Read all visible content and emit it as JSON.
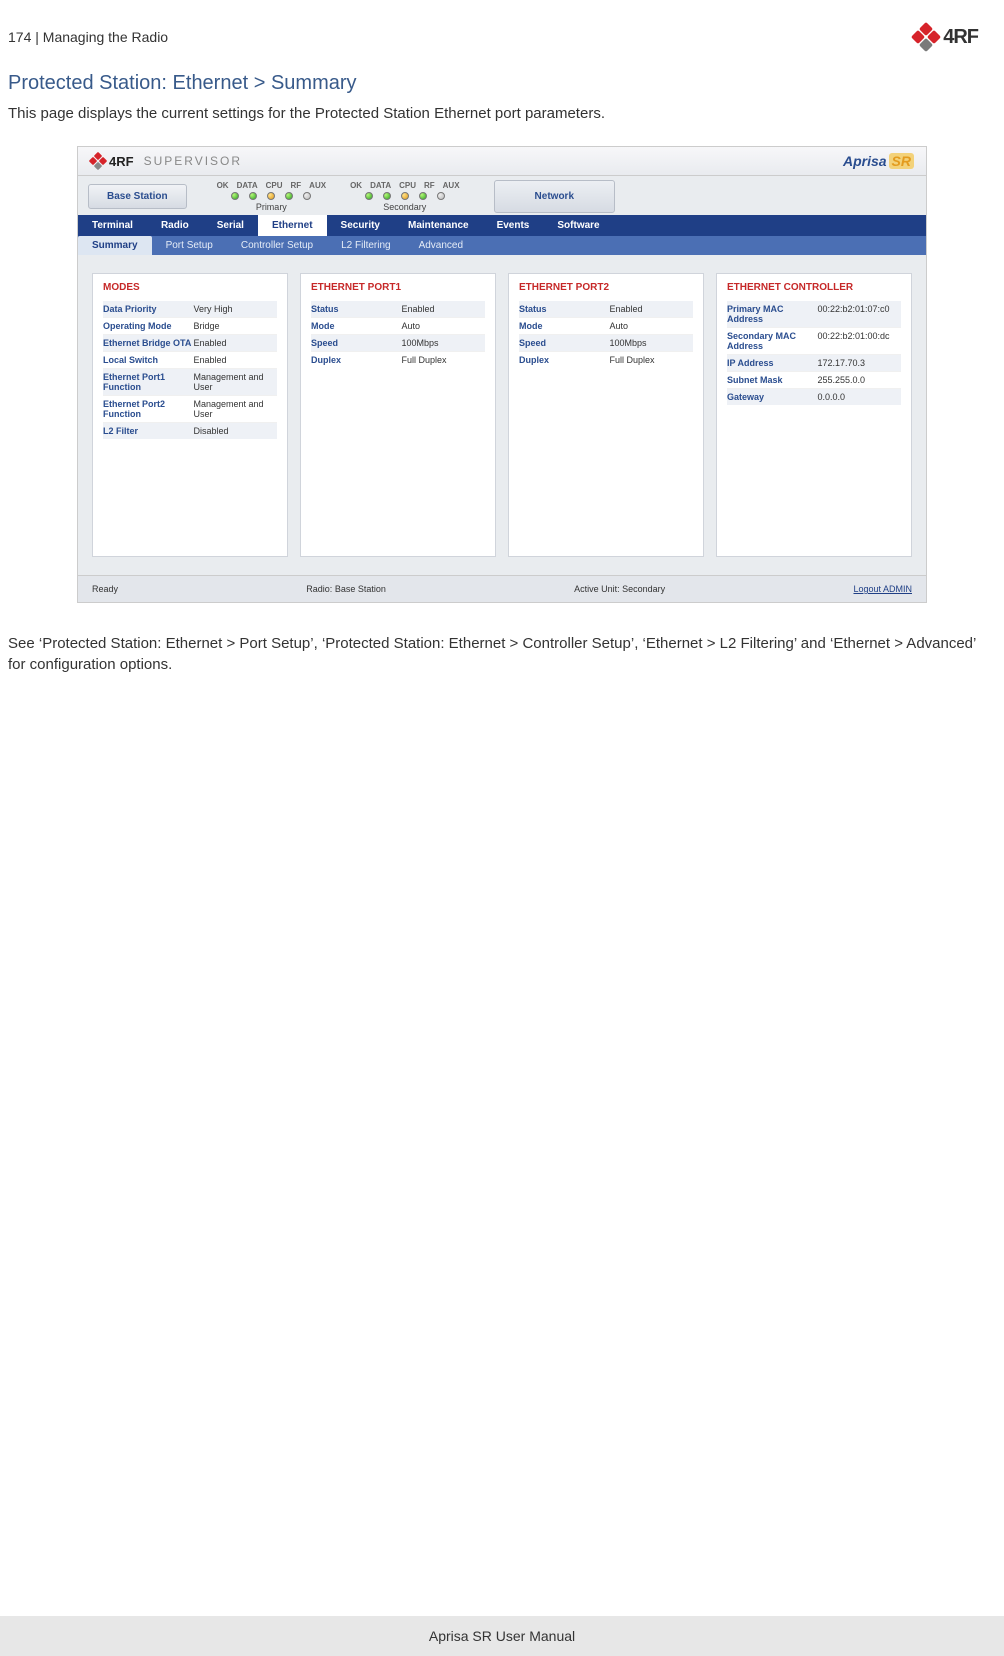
{
  "page": {
    "number": "174",
    "separator": "|",
    "section": "Managing the Radio",
    "brand": "4RF"
  },
  "heading": "Protected Station: Ethernet > Summary",
  "intro": "This page displays the current settings for the Protected Station Ethernet port parameters.",
  "app": {
    "logo_text": "4RF",
    "supervisor": "SUPERVISOR",
    "badge_main": "Aprisa",
    "badge_suffix": "SR",
    "base_station": "Base Station",
    "network": "Network",
    "led_labels": [
      "OK",
      "DATA",
      "CPU",
      "RF",
      "AUX"
    ],
    "group1": "Primary",
    "group2": "Secondary",
    "tabs": [
      "Terminal",
      "Radio",
      "Serial",
      "Ethernet",
      "Security",
      "Maintenance",
      "Events",
      "Software"
    ],
    "active_tab": "Ethernet",
    "subtabs": [
      "Summary",
      "Port Setup",
      "Controller Setup",
      "L2 Filtering",
      "Advanced"
    ],
    "active_subtab": "Summary",
    "panels": {
      "modes": {
        "title": "MODES",
        "rows": [
          {
            "k": "Data Priority",
            "v": "Very High"
          },
          {
            "k": "Operating Mode",
            "v": "Bridge"
          },
          {
            "k": "Ethernet Bridge OTA",
            "v": "Enabled"
          },
          {
            "k": "Local Switch",
            "v": "Enabled"
          },
          {
            "k": "Ethernet Port1 Function",
            "v": "Management and User"
          },
          {
            "k": "Ethernet Port2 Function",
            "v": "Management and User"
          },
          {
            "k": "L2 Filter",
            "v": "Disabled"
          }
        ]
      },
      "port1": {
        "title": "ETHERNET PORT1",
        "rows": [
          {
            "k": "Status",
            "v": "Enabled"
          },
          {
            "k": "Mode",
            "v": "Auto"
          },
          {
            "k": "Speed",
            "v": "100Mbps"
          },
          {
            "k": "Duplex",
            "v": "Full Duplex"
          }
        ]
      },
      "port2": {
        "title": "ETHERNET PORT2",
        "rows": [
          {
            "k": "Status",
            "v": "Enabled"
          },
          {
            "k": "Mode",
            "v": "Auto"
          },
          {
            "k": "Speed",
            "v": "100Mbps"
          },
          {
            "k": "Duplex",
            "v": "Full Duplex"
          }
        ]
      },
      "controller": {
        "title": "ETHERNET CONTROLLER",
        "rows": [
          {
            "k": "Primary MAC Address",
            "v": "00:22:b2:01:07:c0"
          },
          {
            "k": "Secondary MAC Address",
            "v": "00:22:b2:01:00:dc"
          },
          {
            "k": "IP Address",
            "v": "172.17.70.3"
          },
          {
            "k": "Subnet Mask",
            "v": "255.255.0.0"
          },
          {
            "k": "Gateway",
            "v": "0.0.0.0"
          }
        ]
      }
    },
    "footer": {
      "status": "Ready",
      "radio": "Radio: Base Station",
      "active": "Active Unit: Secondary",
      "logout": "Logout ADMIN"
    }
  },
  "after": "See ‘Protected Station: Ethernet > Port Setup’, ‘Protected Station: Ethernet > Controller Setup’, ‘Ethernet > L2 Filtering’ and ‘Ethernet > Advanced’ for configuration options.",
  "manual_footer": "Aprisa SR User Manual"
}
